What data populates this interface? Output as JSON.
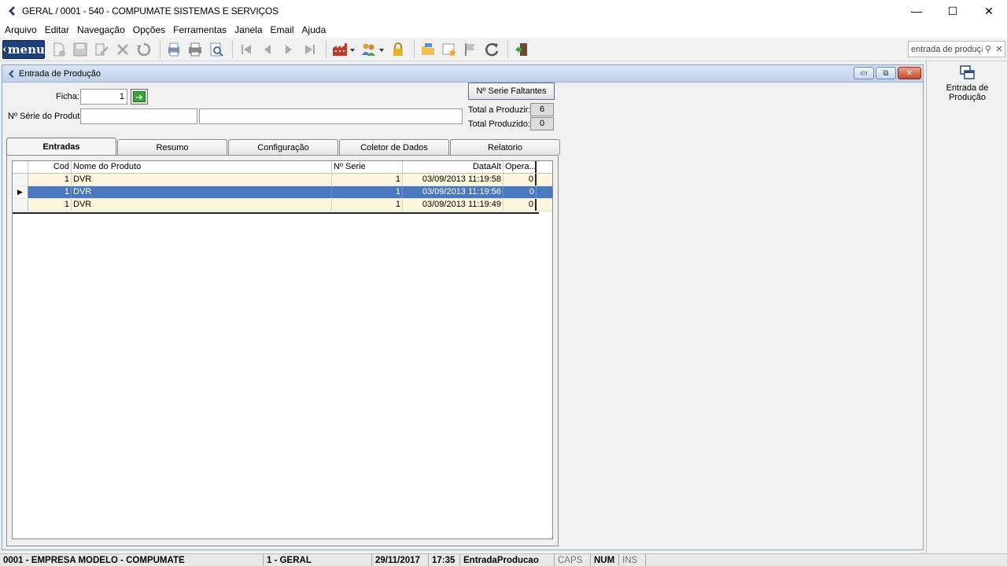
{
  "window": {
    "title": "GERAL / 0001 - 540 - COMPUMATE SISTEMAS E SERVIÇOS",
    "minimize_symbol": "—",
    "maximize_symbol": "☐",
    "close_symbol": "✕"
  },
  "menubar": {
    "items": [
      "Arquivo",
      "Editar",
      "Navegação",
      "Opções",
      "Ferramentas",
      "Janela",
      "Email",
      "Ajuda"
    ]
  },
  "toolbar": {
    "menu_label": "menu",
    "search_placeholder": "entrada de produção",
    "icons": [
      "new-icon",
      "save-icon",
      "edit-icon",
      "delete-icon",
      "undo-icon",
      "print-preview-icon",
      "print-icon",
      "find-icon",
      "first-icon",
      "prev-icon",
      "next-icon",
      "last-icon",
      "factory-icon",
      "users-icon",
      "lock-icon",
      "folder-icon",
      "favorite-icon",
      "flag-icon",
      "refresh-icon",
      "exit-icon"
    ]
  },
  "right_panel": {
    "item_label": "Entrada de Produção"
  },
  "form": {
    "title": "Entrada de Produção",
    "ficha_label": "Ficha:",
    "ficha_value": "1",
    "serie_label": "Nº Série do Produto:",
    "serie_value": "",
    "serie_desc": "",
    "faltantes_button": "Nº Serie Faltantes",
    "total_produzir_label": "Total a Produzir:",
    "total_produzir_value": "6",
    "total_produzido_label": "Total Produzido:",
    "total_produzido_value": "0",
    "win_min": "▭",
    "win_restore": "⧉",
    "win_close": "✕"
  },
  "tabs": [
    "Entradas",
    "Resumo",
    "Configuração",
    "Coletor de Dados",
    "Relatorio"
  ],
  "grid": {
    "headers": {
      "cod": "Cod",
      "nome": "Nome do Produto",
      "serie": "Nº Serie",
      "data": "DataAlt",
      "op": "Opera..."
    },
    "rows": [
      {
        "cod": "1",
        "nome": "DVR",
        "serie": "1",
        "data": "03/09/2013   11:19:58",
        "op": "0",
        "marker": ""
      },
      {
        "cod": "1",
        "nome": "DVR",
        "serie": "1",
        "data": "03/09/2013   11:19:56",
        "op": "0",
        "marker": "▶"
      },
      {
        "cod": "1",
        "nome": "DVR",
        "serie": "1",
        "data": "03/09/2013   11:19:49",
        "op": "0",
        "marker": ""
      }
    ]
  },
  "statusbar": {
    "empresa": "0001 - EMPRESA MODELO - COMPUMATE",
    "geral": "1 - GERAL",
    "date": "29/11/2017",
    "time": "17:35",
    "form": "EntradaProducao",
    "caps": "CAPS",
    "num": "NUM",
    "ins": "INS"
  }
}
